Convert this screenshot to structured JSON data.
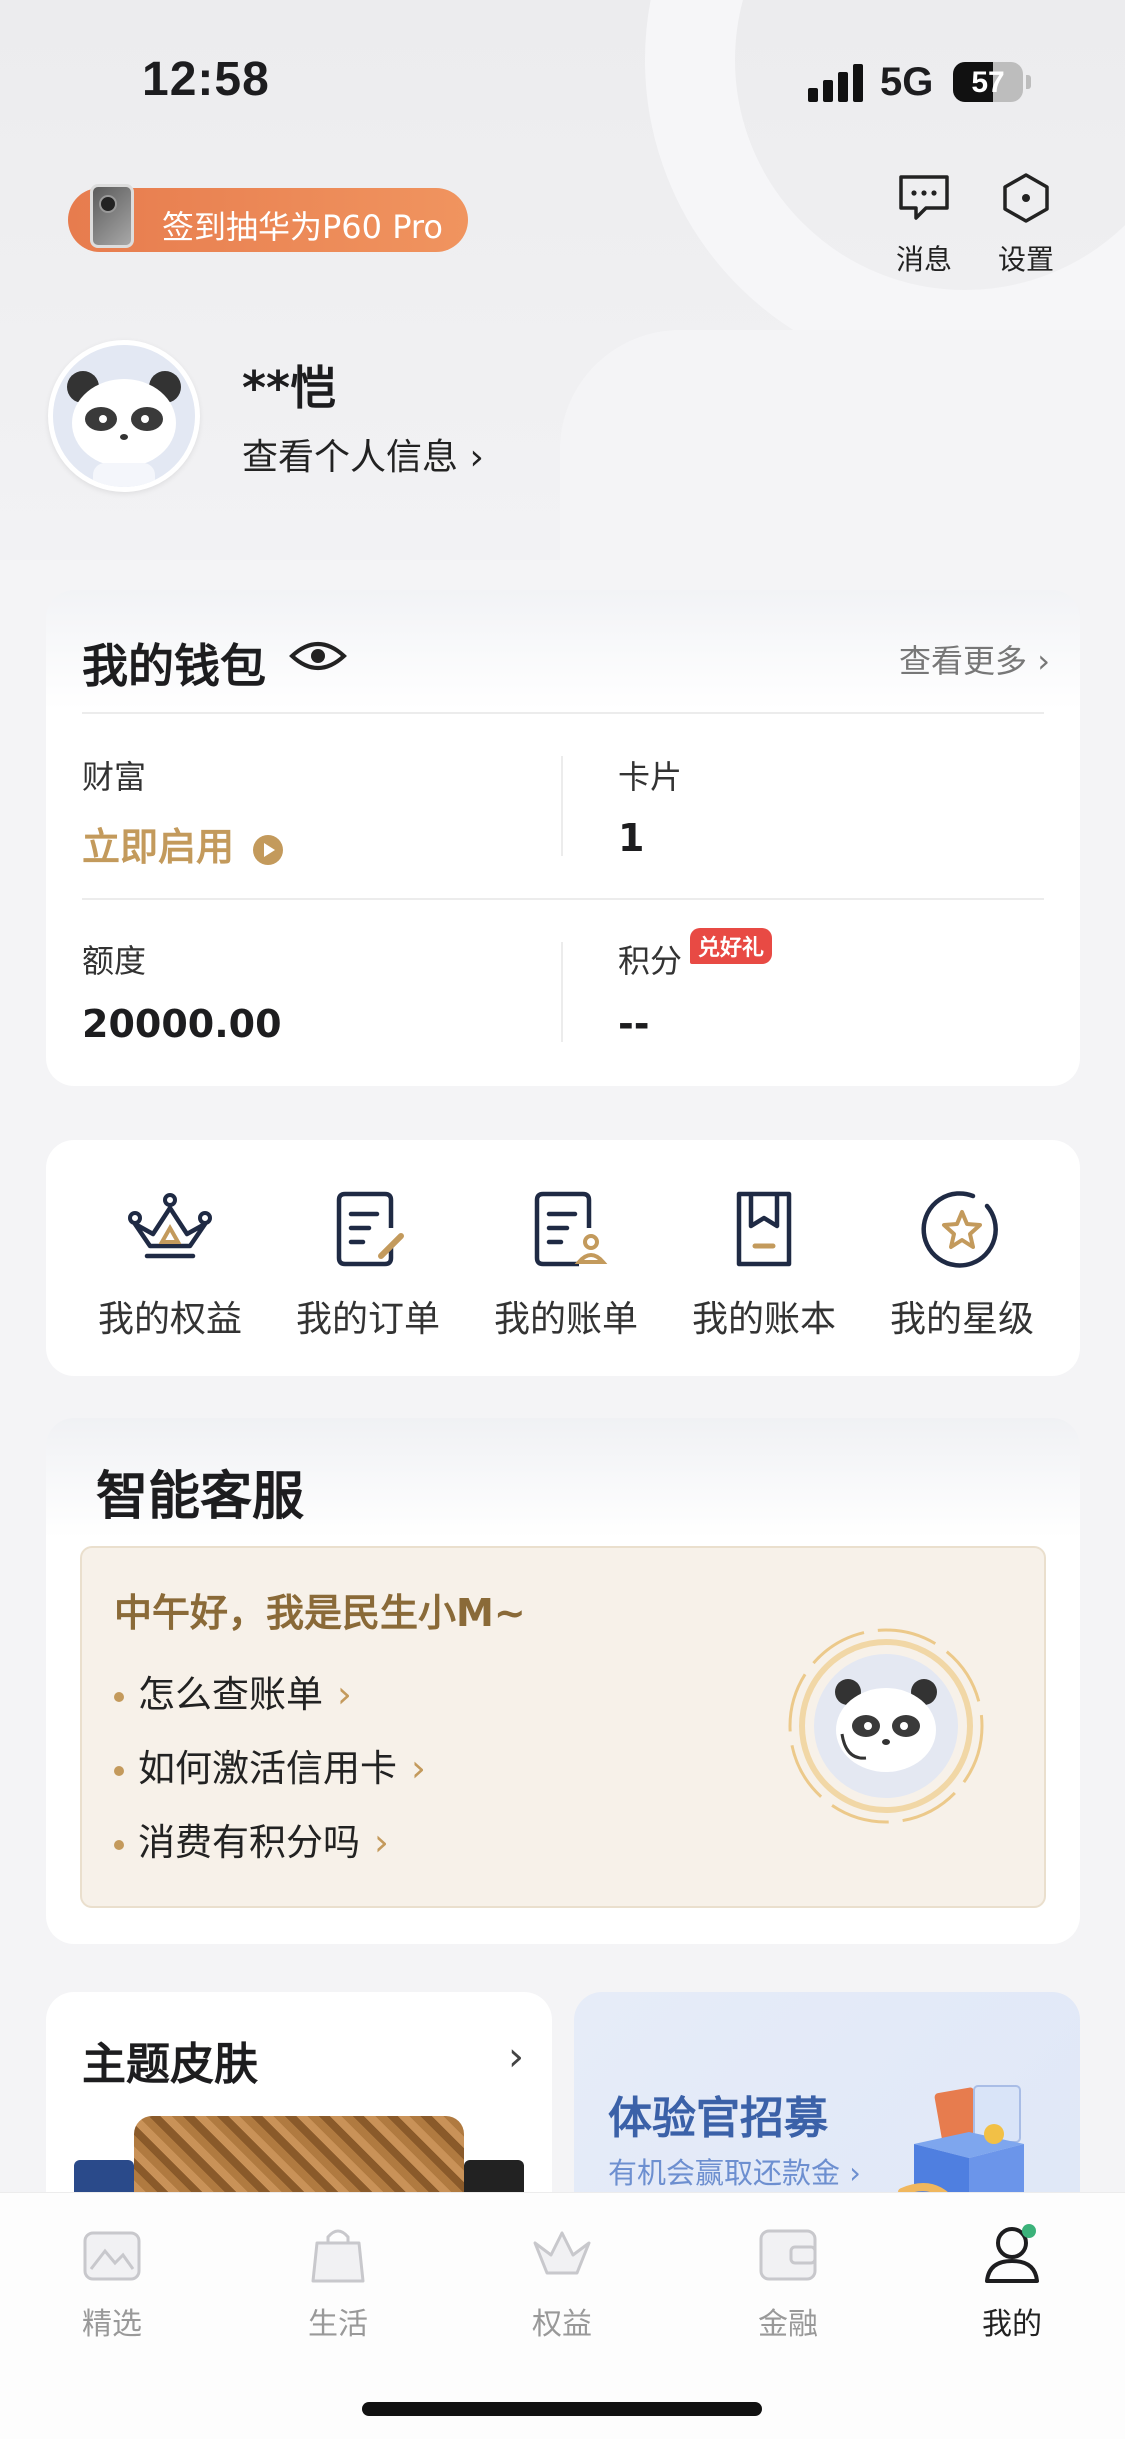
{
  "status_bar": {
    "time": "12:58",
    "network": "5G",
    "battery": "57",
    "battery_level": 0.57
  },
  "header": {
    "promo_label": "签到抽华为P60 Pro",
    "messages_label": "消息",
    "settings_label": "设置"
  },
  "profile": {
    "name": "**恺",
    "info_link": "查看个人信息 ›"
  },
  "wallet": {
    "title": "我的钱包",
    "more": "查看更多 ›",
    "wealth_label": "财富",
    "wealth_value": "立即启用",
    "cards_label": "卡片",
    "cards_value": "1",
    "limit_label": "额度",
    "limit_value": "20000.00",
    "points_label": "积分",
    "points_badge": "兑好礼",
    "points_value": "--"
  },
  "quick_actions": [
    {
      "label": "我的权益"
    },
    {
      "label": "我的订单"
    },
    {
      "label": "我的账单"
    },
    {
      "label": "我的账本"
    },
    {
      "label": "我的星级"
    }
  ],
  "service": {
    "title": "智能客服",
    "greeting": "中午好，我是民生小M~",
    "questions": [
      "怎么查账单",
      "如何激活信用卡",
      "消费有积分吗"
    ]
  },
  "theme_card": {
    "title": "主题皮肤"
  },
  "recruit_card": {
    "title": "体验官招募",
    "subtitle": "有机会赢取还款金 ›"
  },
  "tabs": [
    {
      "label": "精选",
      "active": false
    },
    {
      "label": "生活",
      "active": false
    },
    {
      "label": "权益",
      "active": false
    },
    {
      "label": "金融",
      "active": false
    },
    {
      "label": "我的",
      "active": true
    }
  ],
  "colors": {
    "accent_gold": "#c39a5c",
    "promo_orange": "#e77c4e",
    "badge_red": "#e84a44",
    "recruit_blue": "#3b61a8"
  }
}
